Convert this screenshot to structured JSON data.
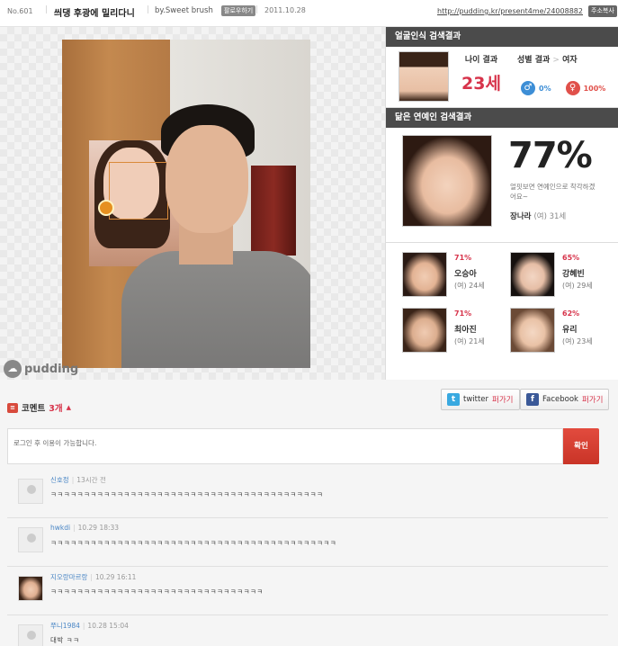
{
  "header": {
    "no": "No.601",
    "title": "씌댕 후광에 밀리다니",
    "by": "by.Sweet brush",
    "follow_badge": "팔로우하기",
    "date": "2011.10.28",
    "url": "http://pudding.kr/present4me/24008882",
    "copy_button": "주소복사"
  },
  "photo": {
    "watermark": "pudding"
  },
  "face_result": {
    "heading": "얼굴인식 검색결과",
    "age_label": "나이 결과",
    "age_value": "23세",
    "gender_label": "성별 결과",
    "gender_arrow": ">",
    "gender_value": "여자",
    "male_pct": "0%",
    "female_pct": "100%",
    "male_color": "#3d8ed6",
    "female_color": "#e0504a"
  },
  "celeb_result": {
    "heading": "닮은 연예인 검색결과",
    "top_pct": "77%",
    "top_desc": "얼핏보면 연예인으로 착각하겠어요~",
    "top_name": "장나라",
    "top_age": "(여) 31세",
    "others": [
      {
        "pct": "71%",
        "name": "오승아",
        "age": "(여) 24세"
      },
      {
        "pct": "65%",
        "name": "강혜빈",
        "age": "(여) 29세"
      },
      {
        "pct": "71%",
        "name": "최아진",
        "age": "(여) 21세"
      },
      {
        "pct": "62%",
        "name": "유리",
        "age": "(여) 23세"
      }
    ]
  },
  "comments": {
    "title": "코멘트",
    "count": "3개",
    "twitter_label": "twitter",
    "twitter_post": "퍼가기",
    "facebook_label": "Facebook",
    "facebook_post": "퍼가기",
    "input_placeholder": "로그인 후 이용이 가능합니다.",
    "submit": "확인",
    "items": [
      {
        "author": "신호정",
        "time": "13시간 전",
        "text": "ㅋㅋㅋㅋㅋㅋㅋㅋㅋㅋㅋㅋㅋㅋㅋㅋㅋㅋㅋㅋㅋㅋㅋㅋㅋㅋㅋㅋㅋㅋㅋㅋㅋㅋㅋㅋㅋㅋㅋㅋㅋ"
      },
      {
        "author": "hwkdi",
        "time": "10.29 18:33",
        "text": "ㅋㅋㅋㅋㅋㅋㅋㅋㅋㅋㅋㅋㅋㅋㅋㅋㅋㅋㅋㅋㅋㅋㅋㅋㅋㅋㅋㅋㅋㅋㅋㅋㅋㅋㅋㅋㅋㅋㅋㅋㅋㅋㅋ"
      },
      {
        "author": "지오랑마르랑",
        "time": "10.29 16:11",
        "text": "ㅋㅋㅋㅋㅋㅋㅋㅋㅋㅋㅋㅋㅋㅋㅋㅋㅋㅋㅋㅋㅋㅋㅋㅋㅋㅋㅋㅋㅋㅋㅋㅋ"
      },
      {
        "author": "쭈니1984",
        "time": "10.28 15:04",
        "text": "대박 ㅋㅋ"
      }
    ]
  }
}
